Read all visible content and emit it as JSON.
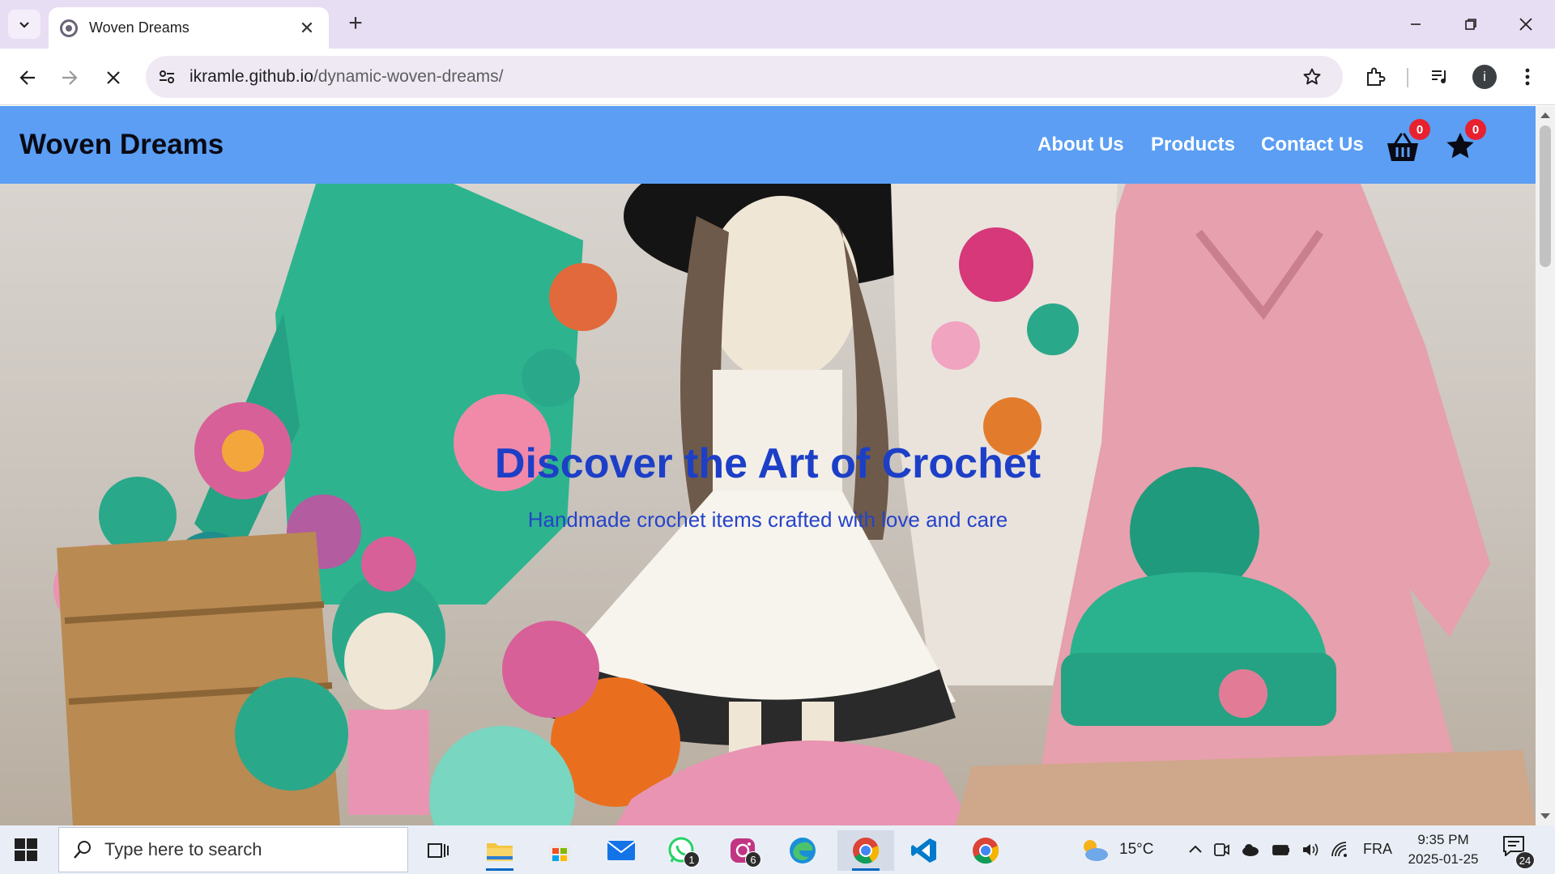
{
  "browser": {
    "tab_title": "Woven Dreams",
    "url_host": "ikramle.github.io",
    "url_path": "/dynamic-woven-dreams/"
  },
  "site": {
    "logo": "Woven Dreams",
    "nav": [
      "About Us",
      "Products",
      "Contact Us"
    ],
    "cart_count": "0",
    "favorites_count": "0",
    "hero_title": "Discover the Art of Crochet",
    "hero_subtitle": "Handmade crochet items crafted with love and care"
  },
  "taskbar": {
    "search_placeholder": "Type here to search",
    "whatsapp_count": "1",
    "instagram_count": "6",
    "temperature": "15°C",
    "language": "FRA",
    "time": "9:35 PM",
    "date": "2025-01-25",
    "notifications": "24"
  },
  "colors": {
    "header_bg": "#5b9ef4",
    "hero_text": "#1d3fc7",
    "badge": "#e8212f"
  }
}
